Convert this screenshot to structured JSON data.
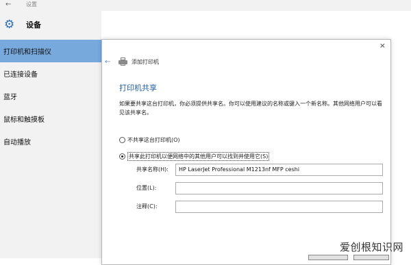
{
  "window": {
    "title": "设置"
  },
  "app": {
    "name": "设备",
    "icon": "gear-icon"
  },
  "sidebar": {
    "items": [
      {
        "label": "打印机和扫描仪",
        "active": true
      },
      {
        "label": "已连接设备",
        "active": false
      },
      {
        "label": "蓝牙",
        "active": false
      },
      {
        "label": "鼠标和触摸板",
        "active": false
      },
      {
        "label": "自动播放",
        "active": false
      }
    ]
  },
  "dialog": {
    "close_glyph": "×",
    "back_glyph": "←",
    "breadcrumb": "添加打印机",
    "heading": "打印机共享",
    "description": "如果要共享这台打印机，你必须提供共享名。你可以使用建议的名称或键入一个新名称。其他网络用户可以看见该共享名。",
    "options": [
      {
        "label": "不共享这台打印机(O)",
        "checked": false
      },
      {
        "label": "共享此打印机以便网络中的其他用户可以找到并使用它(S)",
        "checked": true
      }
    ],
    "fields": {
      "share_name": {
        "label": "共享名称(H):",
        "value": "HP LaserJet Professional M1213nf MFP ceshi"
      },
      "location": {
        "label": "位置(L):",
        "value": ""
      },
      "comment": {
        "label": "注释(C):",
        "value": ""
      }
    }
  },
  "watermark": "爱创根知识网",
  "colors": {
    "accent": "#1c5fa6",
    "nav_active": "#78a9dc",
    "gear": "#2d6fb4"
  }
}
